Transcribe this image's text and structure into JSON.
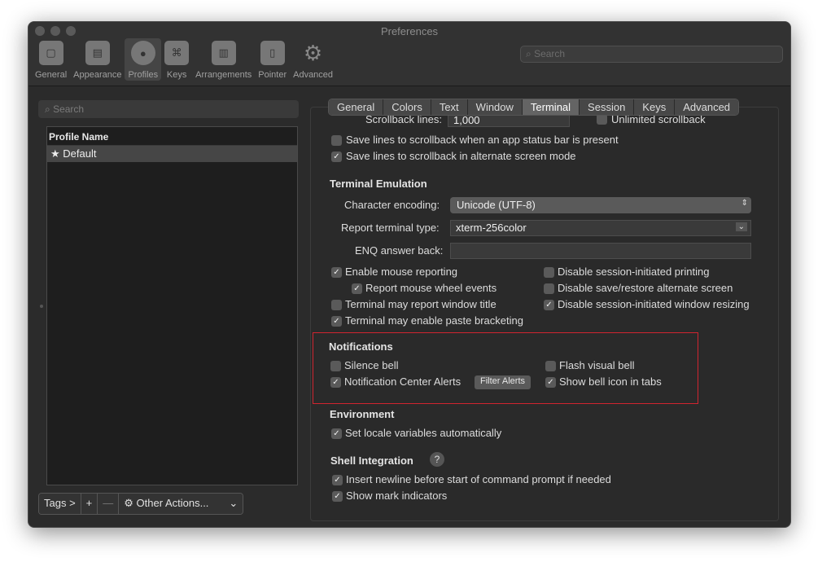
{
  "window": {
    "title": "Preferences"
  },
  "toolbar": {
    "items": [
      {
        "label": "General",
        "icon": "general-icon"
      },
      {
        "label": "Appearance",
        "icon": "appearance-icon"
      },
      {
        "label": "Profiles",
        "icon": "profiles-icon"
      },
      {
        "label": "Keys",
        "icon": "keys-icon"
      },
      {
        "label": "Arrangements",
        "icon": "arrangements-icon"
      },
      {
        "label": "Pointer",
        "icon": "pointer-icon"
      },
      {
        "label": "Advanced",
        "icon": "gear-icon"
      }
    ],
    "selected": "Profiles",
    "search_placeholder": "Search"
  },
  "left": {
    "search_placeholder": "Search",
    "list_header": "Profile Name",
    "profiles": [
      {
        "name": "Default",
        "icon": "star-icon"
      }
    ],
    "bottom": {
      "tags": "Tags >",
      "add": "+",
      "remove": "—",
      "other_actions": "Other Actions...",
      "other_actions_arrow": "⌄"
    }
  },
  "tabs": {
    "items": [
      "General",
      "Colors",
      "Text",
      "Window",
      "Terminal",
      "Session",
      "Keys",
      "Advanced"
    ],
    "selected": "Terminal"
  },
  "terminal": {
    "scrollback_label": "Scrollback lines:",
    "scrollback_value": "1,000",
    "unlimited": {
      "label": "Unlimited scrollback",
      "checked": false
    },
    "save_status_bar": {
      "label": "Save lines to scrollback when an app status bar is present",
      "checked": false
    },
    "save_alt_screen": {
      "label": "Save lines to scrollback in alternate screen mode",
      "checked": true
    },
    "emulation": {
      "heading": "Terminal Emulation",
      "encoding_label": "Character encoding:",
      "encoding_value": "Unicode (UTF-8)",
      "report_type_label": "Report terminal type:",
      "report_type_value": "xterm-256color",
      "enq_label": "ENQ answer back:",
      "enq_value": ""
    },
    "options_left": [
      {
        "label": "Enable mouse reporting",
        "checked": true
      },
      {
        "label": "Report mouse wheel events",
        "checked": true
      },
      {
        "label": "Terminal may report window title",
        "checked": false
      },
      {
        "label": "Terminal may enable paste bracketing",
        "checked": true
      }
    ],
    "options_right": [
      {
        "label": "Disable session-initiated printing",
        "checked": false
      },
      {
        "label": "Disable save/restore alternate screen",
        "checked": false
      },
      {
        "label": "Disable session-initiated window resizing",
        "checked": true
      }
    ],
    "notifications": {
      "heading": "Notifications",
      "silence_bell": {
        "label": "Silence bell",
        "checked": false
      },
      "flash_visual_bell": {
        "label": "Flash visual bell",
        "checked": false
      },
      "notification_center": {
        "label": "Notification Center Alerts",
        "checked": true
      },
      "filter_alerts": "Filter Alerts",
      "show_bell_icon": {
        "label": "Show bell icon in tabs",
        "checked": true
      }
    },
    "environment": {
      "heading": "Environment",
      "set_locale": {
        "label": "Set locale variables automatically",
        "checked": true
      }
    },
    "shell_integration": {
      "heading": "Shell Integration",
      "help": "?",
      "insert_newline": {
        "label": "Insert newline before start of command prompt if needed",
        "checked": true
      },
      "show_mark": {
        "label": "Show mark indicators",
        "checked": true
      }
    }
  },
  "colors": {
    "highlight_box": "#d1242f",
    "window_bg": "#2b2b2b",
    "selected_tab": "#646464"
  },
  "glyphs": {
    "check": "✓",
    "star": "★",
    "updown": "⇕",
    "chevron": "⌄",
    "search": "⌕"
  }
}
